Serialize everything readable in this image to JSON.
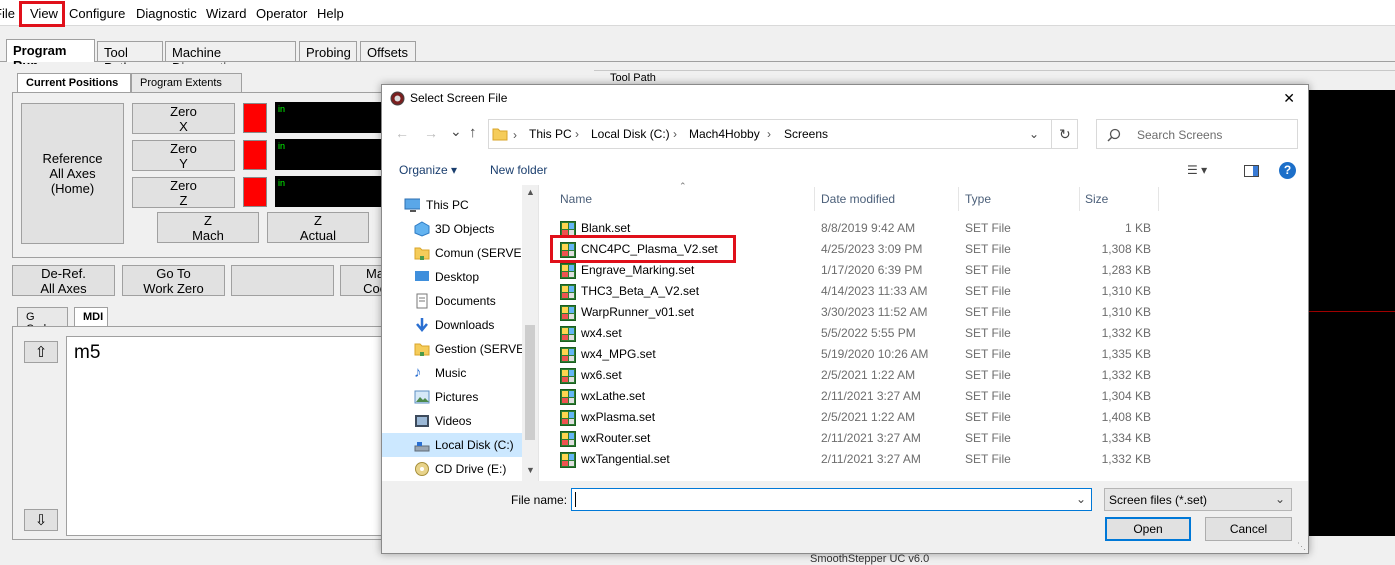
{
  "menu": [
    "File",
    "View",
    "Configure",
    "Diagnostic",
    "Wizard",
    "Operator",
    "Help"
  ],
  "main_tabs": [
    "Program Run",
    "Tool Path",
    "Machine Diagnostics",
    "Probing",
    "Offsets"
  ],
  "positions": {
    "tabs": [
      "Current Positions",
      "Program Extents"
    ],
    "ref_all": "Reference\nAll Axes\n(Home)",
    "zero_x": "Zero\nX",
    "zero_y": "Zero\nY",
    "zero_z": "Zero\nZ",
    "dro_unit": "in",
    "z_mach": "Z\nMach",
    "z_actual": "Z\nActual",
    "deref": "De-Ref.\nAll Axes",
    "goto_zero": "Go To\nWork Zero",
    "partial_btn": "Ma\nCoo"
  },
  "toolpath_label": "Tool Path",
  "gcode": {
    "tabs": [
      "G Code",
      "MDI"
    ],
    "mdi_text": "m5",
    "up": "⇧",
    "down": "⇩"
  },
  "status_partial": "SmoothStepper UC v6.0",
  "dialog": {
    "title": "Select Screen File",
    "close": "✕",
    "breadcrumb": [
      "This PC",
      "Local Disk (C:)",
      "Mach4Hobby",
      "Screens"
    ],
    "search_placeholder": "Search Screens",
    "organize": "Organize",
    "new_folder": "New folder",
    "help": "?",
    "nav": [
      {
        "label": "This PC",
        "icon": "pc-icon"
      },
      {
        "label": "3D Objects",
        "icon": "cube-icon"
      },
      {
        "label": "Comun (SERVER",
        "icon": "folder-icon"
      },
      {
        "label": "Desktop",
        "icon": "desktop-icon"
      },
      {
        "label": "Documents",
        "icon": "documents-icon"
      },
      {
        "label": "Downloads",
        "icon": "download-icon"
      },
      {
        "label": "Gestion (SERVER",
        "icon": "folder-icon"
      },
      {
        "label": "Music",
        "icon": "music-icon"
      },
      {
        "label": "Pictures",
        "icon": "pictures-icon"
      },
      {
        "label": "Videos",
        "icon": "videos-icon"
      },
      {
        "label": "Local Disk (C:)",
        "icon": "disk-icon"
      },
      {
        "label": "CD Drive (E:)",
        "icon": "cd-icon"
      }
    ],
    "columns": {
      "name": "Name",
      "date": "Date modified",
      "type": "Type",
      "size": "Size"
    },
    "files": [
      {
        "name": "Blank.set",
        "date": "8/8/2019 9:42 AM",
        "type": "SET File",
        "size": "1 KB"
      },
      {
        "name": "CNC4PC_Plasma_V2.set",
        "date": "4/25/2023 3:09 PM",
        "type": "SET File",
        "size": "1,308 KB"
      },
      {
        "name": "Engrave_Marking.set",
        "date": "1/17/2020 6:39 PM",
        "type": "SET File",
        "size": "1,283 KB"
      },
      {
        "name": "THC3_Beta_A_V2.set",
        "date": "4/14/2023 11:33 AM",
        "type": "SET File",
        "size": "1,310 KB"
      },
      {
        "name": "WarpRunner_v01.set",
        "date": "3/30/2023 11:52 AM",
        "type": "SET File",
        "size": "1,310 KB"
      },
      {
        "name": "wx4.set",
        "date": "5/5/2022 5:55 PM",
        "type": "SET File",
        "size": "1,332 KB"
      },
      {
        "name": "wx4_MPG.set",
        "date": "5/19/2020 10:26 AM",
        "type": "SET File",
        "size": "1,335 KB"
      },
      {
        "name": "wx6.set",
        "date": "2/5/2021 1:22 AM",
        "type": "SET File",
        "size": "1,332 KB"
      },
      {
        "name": "wxLathe.set",
        "date": "2/11/2021 3:27 AM",
        "type": "SET File",
        "size": "1,304 KB"
      },
      {
        "name": "wxPlasma.set",
        "date": "2/5/2021 1:22 AM",
        "type": "SET File",
        "size": "1,408 KB"
      },
      {
        "name": "wxRouter.set",
        "date": "2/11/2021 3:27 AM",
        "type": "SET File",
        "size": "1,334 KB"
      },
      {
        "name": "wxTangential.set",
        "date": "2/11/2021 3:27 AM",
        "type": "SET File",
        "size": "1,332 KB"
      }
    ],
    "filename_label": "File name:",
    "filename_value": "",
    "filter": "Screen files (*.set)",
    "open": "Open",
    "cancel": "Cancel"
  },
  "colors": {
    "highlight": "#e0101a",
    "accent": "#0078d7"
  }
}
